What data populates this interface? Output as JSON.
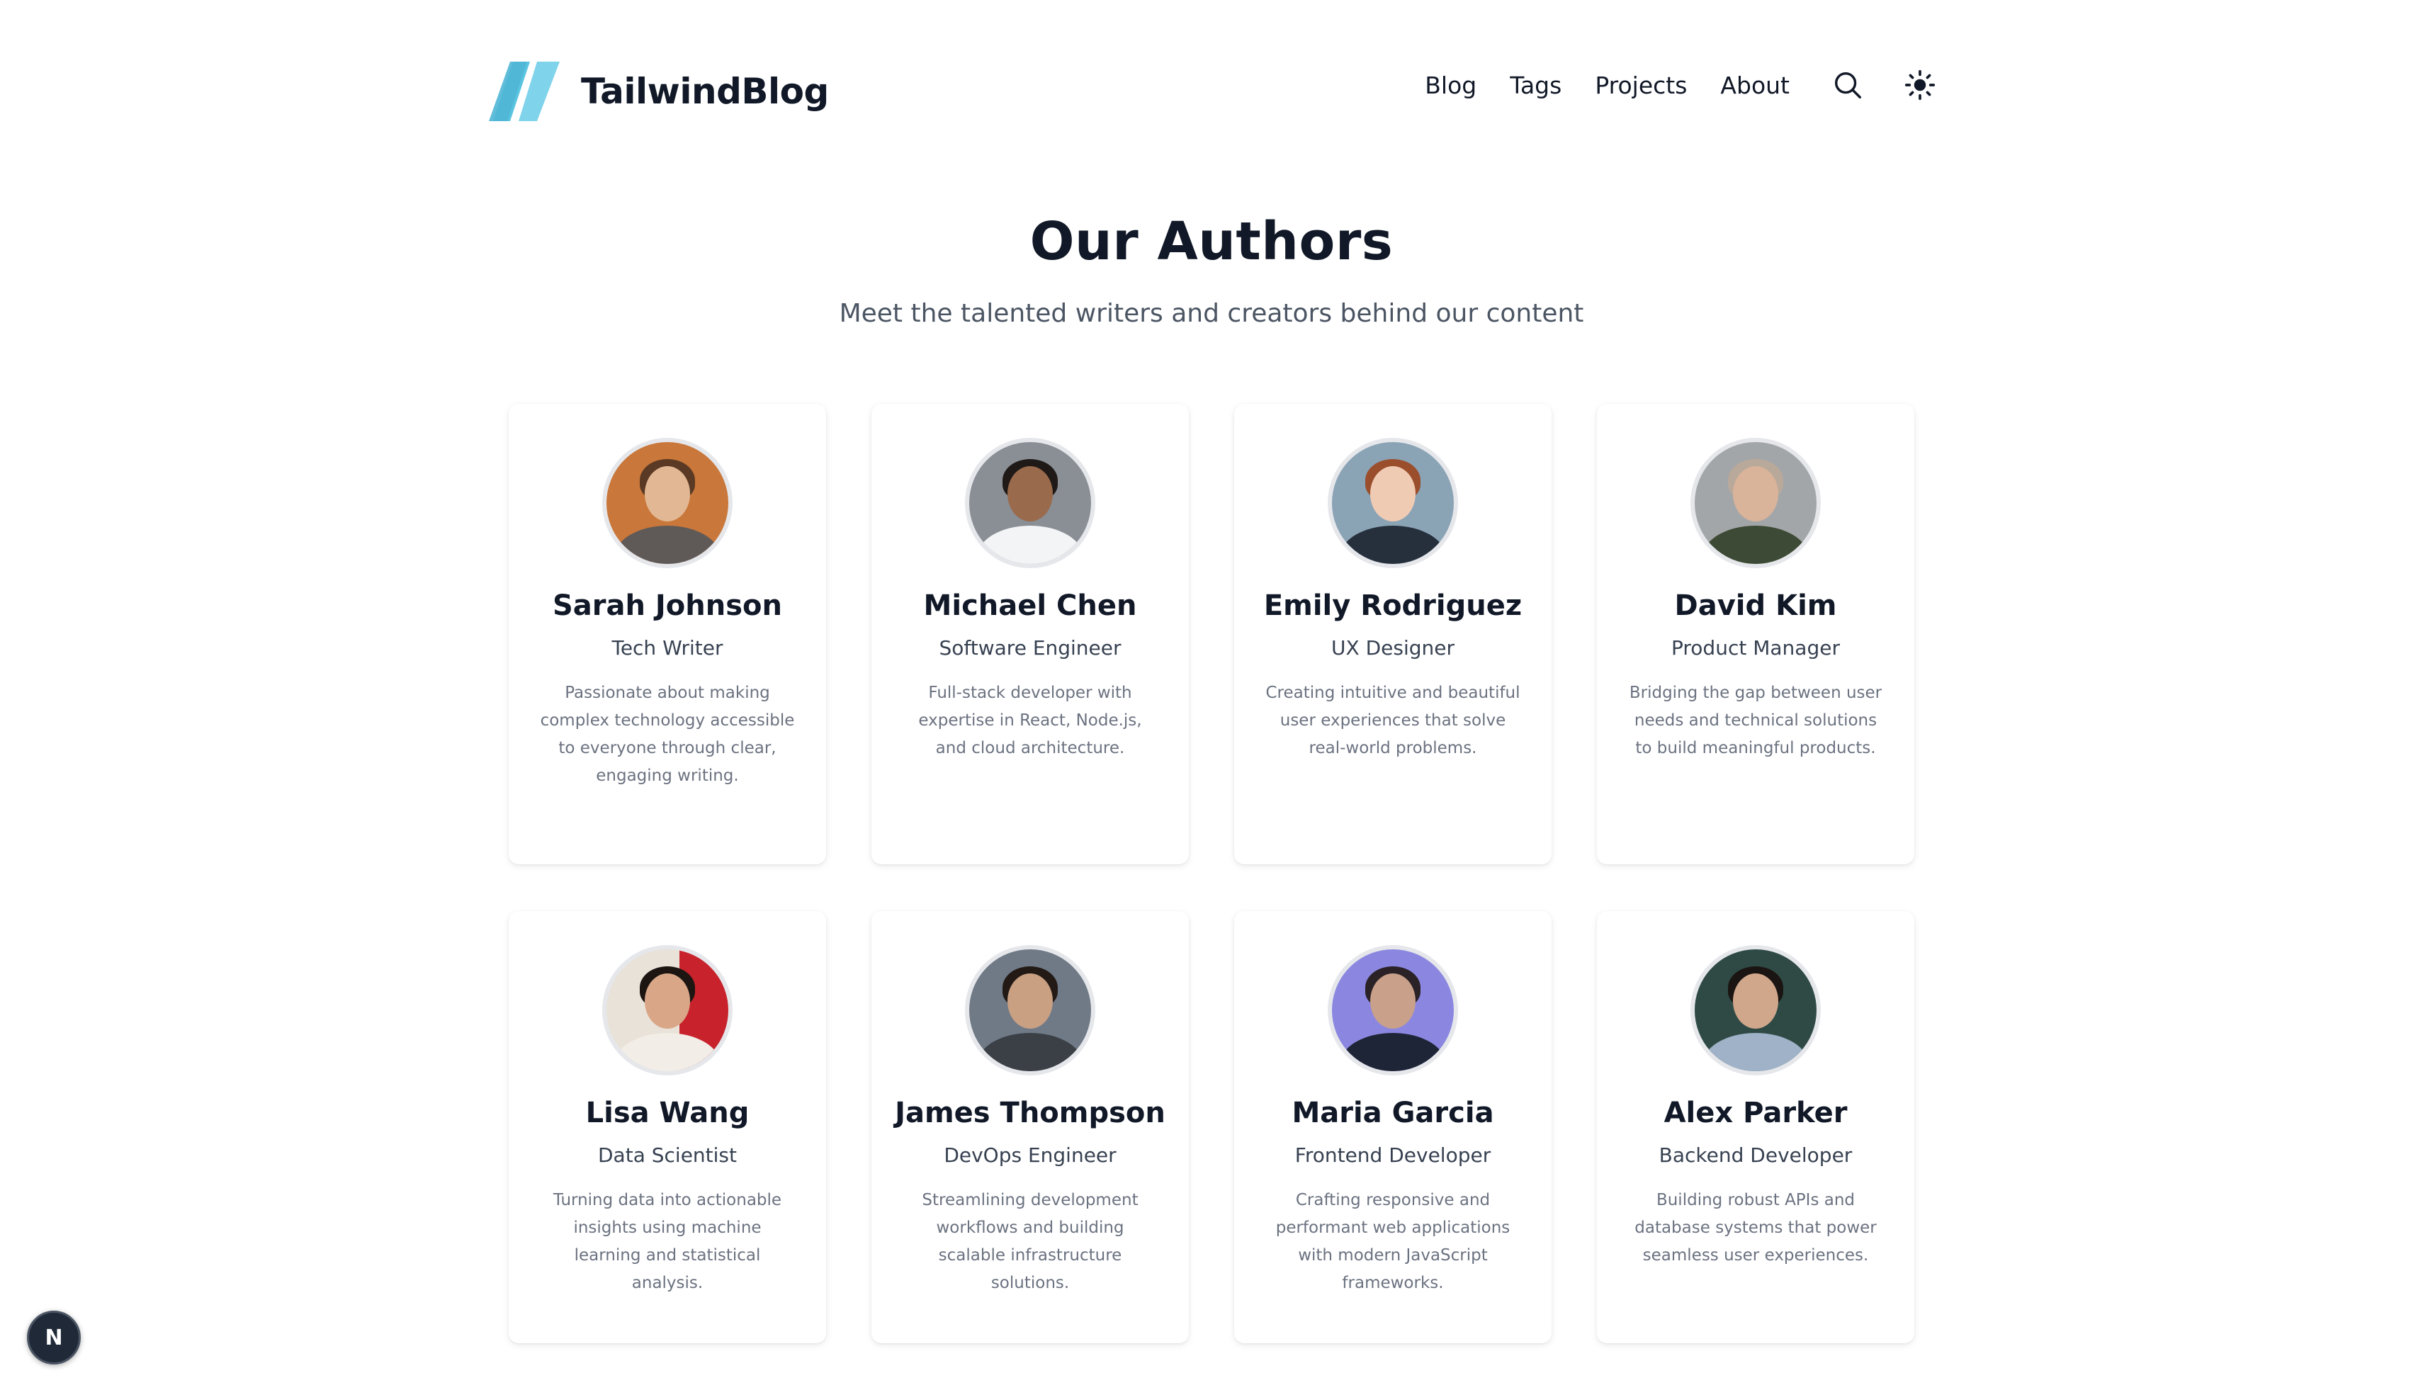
{
  "header": {
    "logo_text": "TailwindBlog",
    "nav": [
      {
        "label": "Blog"
      },
      {
        "label": "Tags"
      },
      {
        "label": "Projects"
      },
      {
        "label": "About"
      }
    ]
  },
  "hero": {
    "title": "Our Authors",
    "subtitle": "Meet the talented writers and creators behind our content"
  },
  "authors": [
    {
      "name": "Sarah Johnson",
      "role": "Tech Writer",
      "bio": "Passionate about making complex technology accessible to everyone through clear, engaging writing."
    },
    {
      "name": "Michael Chen",
      "role": "Software Engineer",
      "bio": "Full-stack developer with expertise in React, Node.js, and cloud architecture."
    },
    {
      "name": "Emily Rodriguez",
      "role": "UX Designer",
      "bio": "Creating intuitive and beautiful user experiences that solve real-world problems."
    },
    {
      "name": "David Kim",
      "role": "Product Manager",
      "bio": "Bridging the gap between user needs and technical solutions to build meaningful products."
    },
    {
      "name": "Lisa Wang",
      "role": "Data Scientist",
      "bio": "Turning data into actionable insights using machine learning and statistical analysis."
    },
    {
      "name": "James Thompson",
      "role": "DevOps Engineer",
      "bio": "Streamlining development workflows and building scalable infrastructure solutions."
    },
    {
      "name": "Maria Garcia",
      "role": "Frontend Developer",
      "bio": "Crafting responsive and performant web applications with modern JavaScript frameworks."
    },
    {
      "name": "Alex Parker",
      "role": "Backend Developer",
      "bio": "Building robust APIs and database systems that power seamless user experiences."
    }
  ],
  "dev_badge": {
    "label": "N"
  },
  "colors": {
    "logo_accent": "#5bc4e0",
    "text_primary": "#111827",
    "text_secondary": "#4b5563",
    "text_muted": "#6b7280"
  }
}
